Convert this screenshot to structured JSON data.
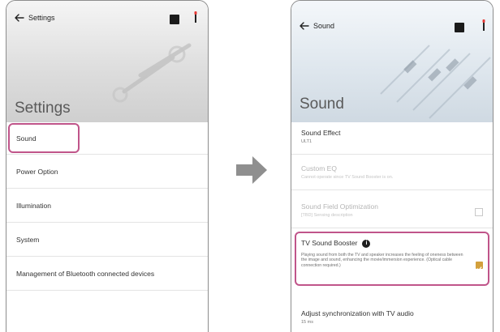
{
  "left_screen": {
    "topbar_title": "Settings",
    "hero_title": "Settings",
    "menu_items": [
      {
        "label": "Sound"
      },
      {
        "label": "Power Option"
      },
      {
        "label": "Illumination"
      },
      {
        "label": "System"
      },
      {
        "label": "Management of Bluetooth connected devices"
      }
    ]
  },
  "right_screen": {
    "topbar_title": "Sound",
    "hero_title": "Sound",
    "sound_effect": {
      "title": "Sound Effect",
      "value": "ULT1"
    },
    "custom_eq": {
      "title": "Custom EQ",
      "subtitle": "Cannot operate since TV Sound Booster is on."
    },
    "sound_field": {
      "title": "Sound Field Optimization",
      "subtitle": "[TBD] Sensing description"
    },
    "tv_booster": {
      "title": "TV Sound Booster",
      "info_glyph": "i",
      "description": "Playing sound from both the TV and speaker increases the feeling of oneness between the image and sound, enhancing the movie/immersion experience. (Optical cable connection required.)",
      "checked": true
    },
    "sync": {
      "title": "Adjust synchronization with TV audio",
      "value": "15 ms"
    }
  },
  "icons": {
    "back": "back-arrow-icon",
    "remote": "remote-icon",
    "power": "power-icon",
    "transition": "right-arrow-icon"
  },
  "colors": {
    "highlight": "#c0558a",
    "checkbox_checked": "#d3a03c",
    "arrow": "#8f8f8f",
    "power_tip": "#e53935"
  }
}
